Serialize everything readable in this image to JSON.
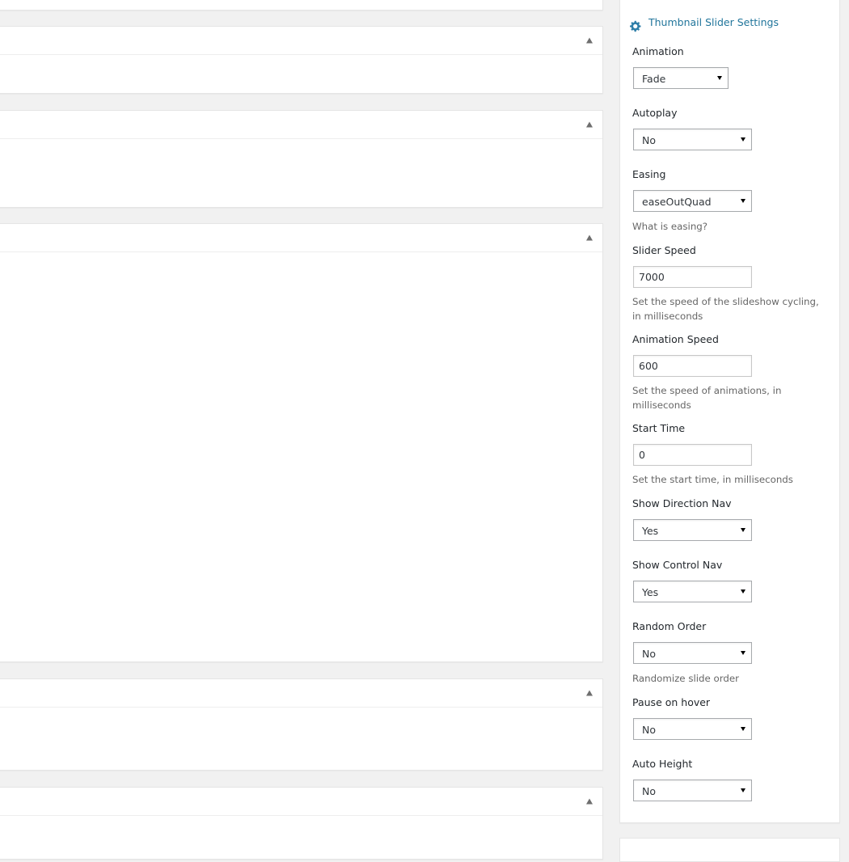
{
  "panel": {
    "title": "Thumbnail Slider Settings",
    "icon": "gear-icon",
    "accent_color": "#21759b"
  },
  "fields": {
    "animation": {
      "label": "Animation",
      "value": "Fade"
    },
    "autoplay": {
      "label": "Autoplay",
      "value": "No"
    },
    "easing": {
      "label": "Easing",
      "value": "easeOutQuad",
      "help": "What is easing?"
    },
    "slider_speed": {
      "label": "Slider Speed",
      "value": "7000",
      "help": "Set the speed of the slideshow cycling, in milliseconds"
    },
    "animation_speed": {
      "label": "Animation Speed",
      "value": "600",
      "help": "Set the speed of animations, in milliseconds"
    },
    "start_time": {
      "label": "Start Time",
      "value": "0",
      "help": "Set the start time, in milliseconds"
    },
    "show_direction_nav": {
      "label": "Show Direction Nav",
      "value": "Yes"
    },
    "show_control_nav": {
      "label": "Show Control Nav",
      "value": "Yes"
    },
    "random_order": {
      "label": "Random Order",
      "value": "No",
      "help": "Randomize slide order"
    },
    "pause_on_hover": {
      "label": "Pause on hover",
      "value": "No"
    },
    "auto_height": {
      "label": "Auto Height",
      "value": "No"
    }
  }
}
